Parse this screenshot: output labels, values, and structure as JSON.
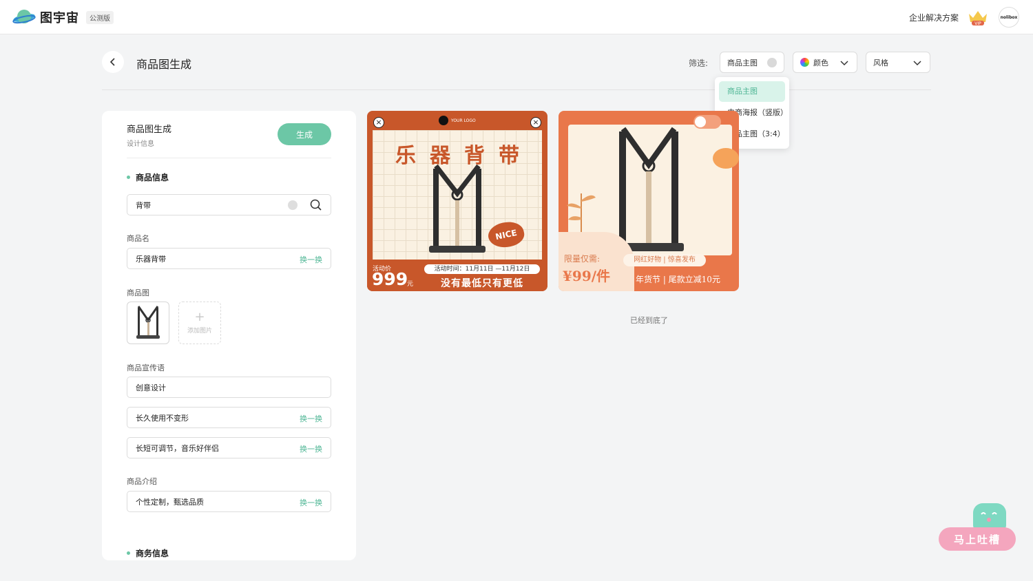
{
  "topbar": {
    "brand": "图宇宙",
    "beta": "公测版",
    "enterprise": "企业解决方案",
    "vip": "VIP",
    "avatar": "nolibox"
  },
  "header": {
    "title": "商品图生成",
    "filter_label": "筛选:",
    "chips": [
      {
        "label": "商品主图"
      },
      {
        "label": "颜色"
      },
      {
        "label": "风格"
      }
    ]
  },
  "dropdown": {
    "items": [
      {
        "label": "商品主图",
        "active": true
      },
      {
        "label": "电商海报（竖版）",
        "active": false
      },
      {
        "label": "商品主图（3:4）",
        "active": false
      }
    ]
  },
  "panel": {
    "title": "商品图生成",
    "subtitle": "设计信息",
    "generate": "生成",
    "product_section": "商品信息",
    "search_value": "背带",
    "name_label": "商品名",
    "name_value": "乐器背带",
    "swap": "换一换",
    "image_label": "商品图",
    "add_image": "添加图片",
    "slogan_label": "商品宣传语",
    "slogans": [
      "创意设计",
      "长久使用不变形",
      "长短可调节，音乐好伴侣"
    ],
    "intro_label": "商品介绍",
    "intro_value": "个性定制，甄选品质",
    "business_section": "商务信息"
  },
  "poster1": {
    "logo": "YOUR LOGO",
    "title": "乐器背带",
    "act_label": "活动价",
    "price": "999",
    "yuan": "元",
    "date": "活动时间：11月11日 —11月12日",
    "slogan": "没有最低只有更低",
    "nice": "NICE"
  },
  "poster2": {
    "limit": "限量仅需:",
    "price": "¥99/件",
    "tag": "网红好物 | 惊喜发布",
    "promo": "年货节 | 尾款立减10元"
  },
  "end_text": "已经到底了",
  "feedback": {
    "label": "马上吐槽"
  },
  "colors": {
    "accent": "#6cc7a6",
    "poster1": "#c8572a",
    "poster2": "#e9774a"
  }
}
